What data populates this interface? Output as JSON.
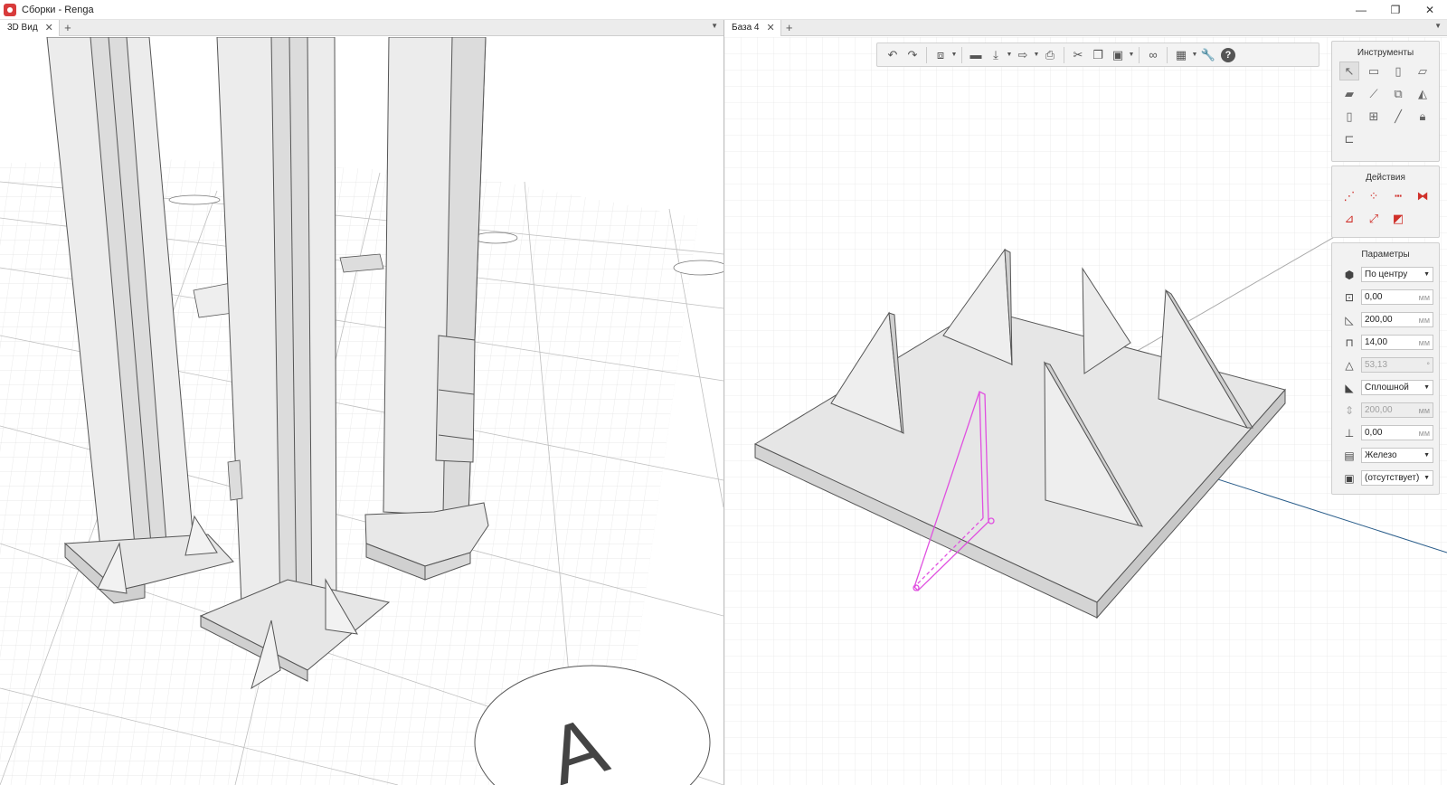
{
  "window": {
    "title": "Сборки - Renga",
    "controls": {
      "minimize": "—",
      "maximize": "❐",
      "close": "✕"
    }
  },
  "left_pane": {
    "tab_label": "3D Вид",
    "add_tab": "+",
    "menu": "▼",
    "axis_bubble_letter": "A"
  },
  "right_pane": {
    "tab_label": "База 4",
    "add_tab": "+",
    "menu": "▼"
  },
  "toolbar": {
    "icons": [
      "undo-icon",
      "redo-icon",
      "view-cube-icon",
      "folder-open-icon",
      "save-icon",
      "export-icon",
      "print-icon",
      "cut-icon",
      "copy-icon",
      "paste-icon",
      "link-icon",
      "grid-view-icon",
      "settings-wrench-icon",
      "help-icon"
    ],
    "help_label": "?"
  },
  "tools_panel": {
    "title": "Инструменты",
    "icons": [
      "select-icon",
      "wall-icon",
      "column-icon",
      "beam-icon",
      "slab-icon",
      "plate-icon",
      "rib-icon",
      "roof-icon",
      "door-icon",
      "window-icon",
      "line-icon",
      "lock-icon",
      "element-icon"
    ]
  },
  "actions_panel": {
    "title": "Действия",
    "icons": [
      "move-icon",
      "rotate-icon",
      "array-icon",
      "mirror-icon",
      "align-icon",
      "scale-icon",
      "delete-icon"
    ]
  },
  "params_panel": {
    "title": "Параметры",
    "alignment": "По центру",
    "offset": "0,00",
    "length": "200,00",
    "thickness": "14,00",
    "angle": "53,13",
    "fill_type": "Сплошной",
    "height_disabled": "200,00",
    "elevation": "0,00",
    "material": "Железо",
    "mark": "(отсутствует)",
    "unit_mm": "мм",
    "unit_deg": "°"
  },
  "colors": {
    "selection": "#e050e0",
    "grid": "#d8d8d8",
    "model_fill": "#e8e8e8",
    "axis_blue": "#2a5d8a"
  }
}
